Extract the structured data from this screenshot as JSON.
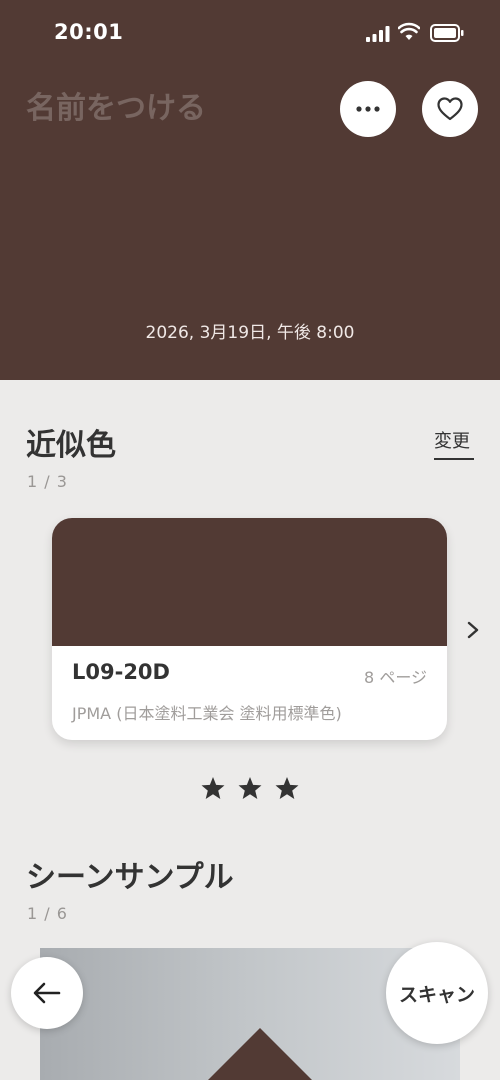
{
  "status_bar": {
    "time": "20:01"
  },
  "header": {
    "name_placeholder": "名前をつける",
    "timestamp": "2026, 3月19日, 午後 8:00",
    "swatch_color": "#523a34"
  },
  "approx": {
    "title": "近似色",
    "count": "1 / 3",
    "change_label": "変更",
    "card": {
      "code": "L09-20D",
      "page": "8 ページ",
      "source": "JPMA (日本塗料工業会 塗料用標準色)",
      "color": "#523a34"
    },
    "rating": 3
  },
  "scene": {
    "title": "シーンサンプル",
    "count": "1 / 6"
  },
  "actions": {
    "scan_label": "スキャン"
  },
  "icons": [
    "signal-icon",
    "wifi-icon",
    "battery-icon",
    "more-icon",
    "heart-icon",
    "chevron-right-icon",
    "star-icon",
    "arrow-left-icon"
  ]
}
